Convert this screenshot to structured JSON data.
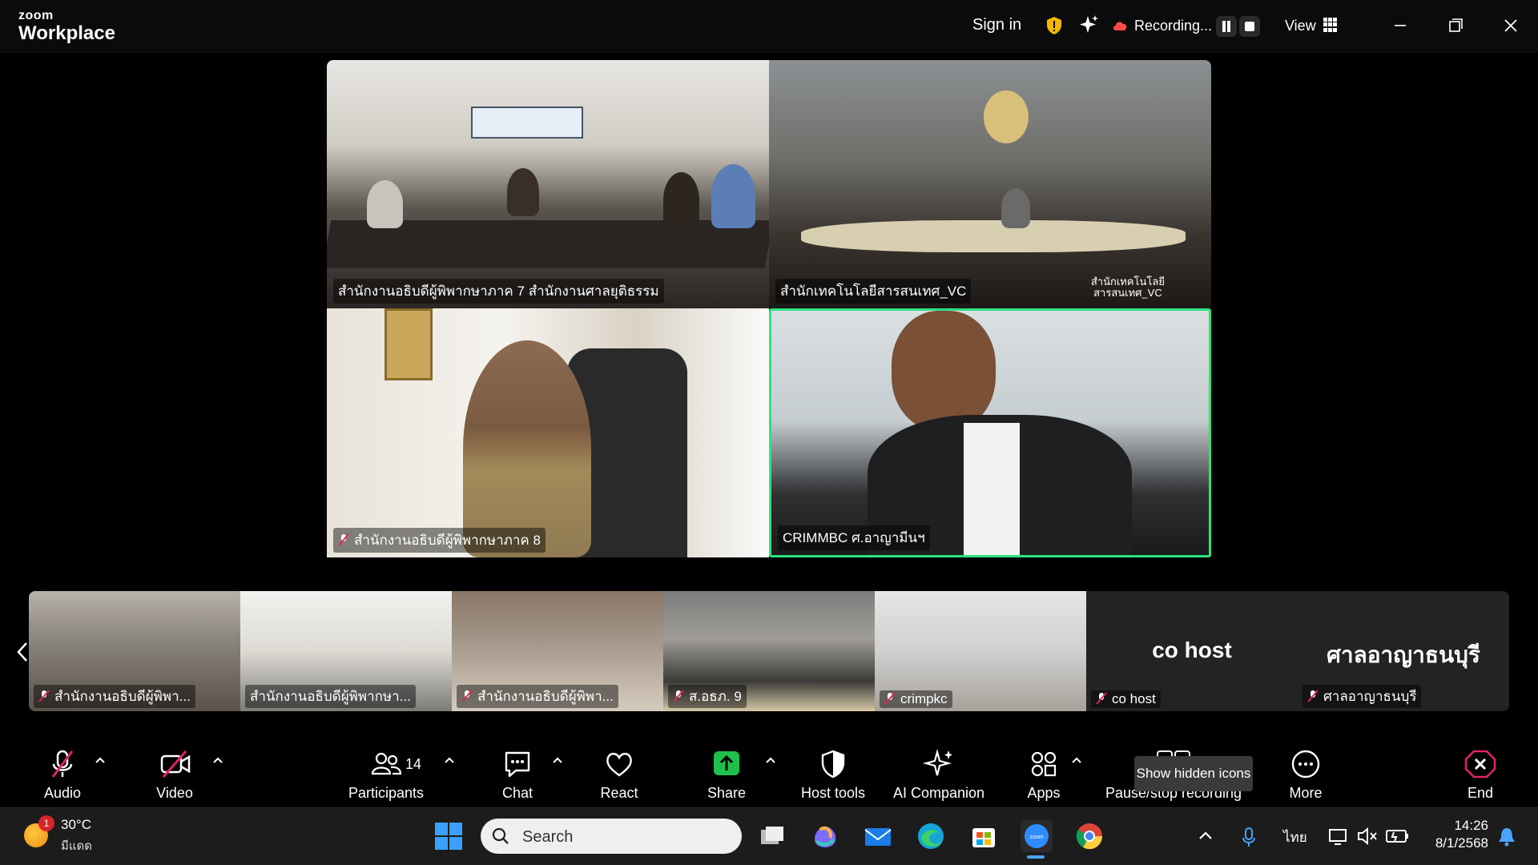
{
  "titlebar": {
    "brand_top": "zoom",
    "brand_bottom": "Workplace",
    "sign_in": "Sign in",
    "recording_label": "Recording...",
    "view_label": "View"
  },
  "gallery": {
    "tiles": [
      {
        "name": "สำนักงานอธิบดีผู้พิพากษาภาค 7 สำนักงานศาลยุติธรรม",
        "muted": false
      },
      {
        "name": "สำนักเทคโนโลยีสารสนเทศ_VC",
        "muted": false
      },
      {
        "name": "สำนักงานอธิบดีผู้พิพากษาภาค 8",
        "muted": true
      },
      {
        "name": "CRIMMBC ศ.อาญามีนฯ",
        "muted": false,
        "active_speaker": true
      }
    ]
  },
  "filmstrip": {
    "tiles": [
      {
        "name": "สำนักงานอธิบดีผู้พิพา...",
        "muted": true
      },
      {
        "name": "สำนักงานอธิบดีผู้พิพากษา...",
        "muted": false
      },
      {
        "name": "สำนักงานอธิบดีผู้พิพา...",
        "muted": true
      },
      {
        "name": "ส.อธภ. 9",
        "muted": true
      },
      {
        "name": "crimpkc",
        "muted": true
      },
      {
        "name": "co host",
        "muted": true,
        "big_label": "co host"
      },
      {
        "name": "ศาลอาญาธนบุรี",
        "muted": true,
        "big_label": "ศาลอาญาธนบุรี"
      }
    ]
  },
  "toolbar": {
    "audio": "Audio",
    "video": "Video",
    "participants": "Participants",
    "participant_count": "14",
    "chat": "Chat",
    "react": "React",
    "share": "Share",
    "host_tools": "Host tools",
    "ai_companion": "AI Companion",
    "apps": "Apps",
    "pause_stop": "Pause/stop recording",
    "more": "More",
    "end": "End",
    "tooltip": "Show hidden icons"
  },
  "taskbar": {
    "temperature": "30°C",
    "condition": "มีแดด",
    "weather_badge": "1",
    "search_placeholder": "Search",
    "language": "ไทย",
    "time": "14:26",
    "date": "8/1/2568"
  },
  "colors": {
    "active_speaker_border": "#2ee27f",
    "share_green": "#1ec14b",
    "end_red": "#e0245e",
    "muted_red": "#e0245e"
  }
}
